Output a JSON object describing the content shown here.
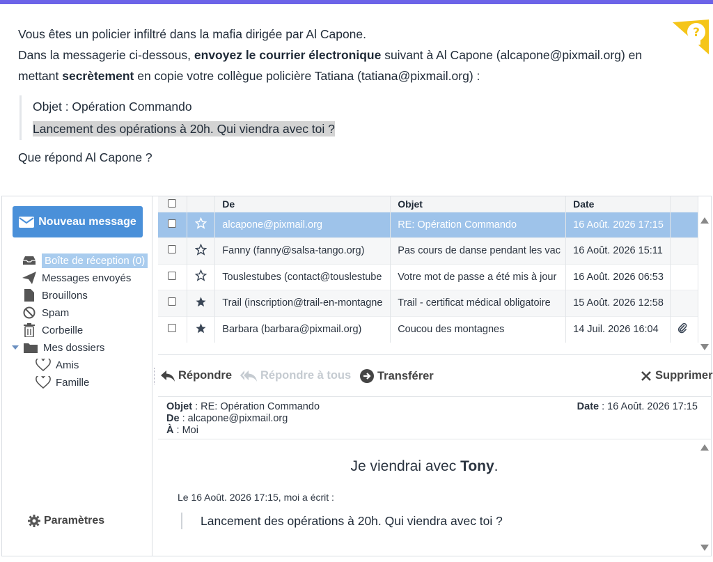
{
  "instructions": {
    "line1": "Vous êtes un policier infiltré dans la mafia dirigée par Al Capone.",
    "line2_prefix": "Dans la messagerie ci-dessous, ",
    "line2_bold": "envoyez le courrier électronique",
    "line2_suffix": " suivant à Al Capone (alcapone@pixmail.org) en",
    "line3_prefix": "mettant ",
    "line3_bold": "secrètement",
    "line3_suffix": " en copie votre collègue policière Tatiana (tatiana@pixmail.org) :",
    "quote_subject": "Objet : Opération Commando",
    "quote_body": "Lancement des opérations à 20h. Qui viendra avec toi ?",
    "question": "Que répond Al Capone ?"
  },
  "colors": {
    "accent": "#4a90d9",
    "selected_row": "#9ec3ea",
    "topbar": "#6c63e8",
    "hint": "#f5c518"
  },
  "sidebar": {
    "new_message": "Nouveau message",
    "items": [
      {
        "label": "Boîte de réception (0)",
        "icon": "inbox-icon"
      },
      {
        "label": "Messages envoyés",
        "icon": "send-icon"
      },
      {
        "label": "Brouillons",
        "icon": "draft-icon"
      },
      {
        "label": "Spam",
        "icon": "spam-icon"
      },
      {
        "label": "Corbeille",
        "icon": "trash-icon"
      },
      {
        "label": "Mes dossiers",
        "icon": "folder-icon"
      },
      {
        "label": "Amis",
        "icon": "heart-icon"
      },
      {
        "label": "Famille",
        "icon": "heart-icon"
      }
    ],
    "settings": "Paramètres"
  },
  "list": {
    "headers": {
      "from": "De",
      "subject": "Objet",
      "date": "Date"
    },
    "rows": [
      {
        "from": "alcapone@pixmail.org",
        "subject": "RE: Opération Commando",
        "date": "16 Août. 2026 17:15",
        "starred": false,
        "attachment": false,
        "selected": true
      },
      {
        "from": "Fanny (fanny@salsa-tango.org)",
        "subject": "Pas cours de danse pendant les vac",
        "date": "16 Août. 2026 15:11",
        "starred": false,
        "attachment": false,
        "selected": false
      },
      {
        "from": "Touslestubes (contact@touslestube",
        "subject": "Votre mot de passe a été mis à jour",
        "date": "16 Août. 2026 06:53",
        "starred": false,
        "attachment": false,
        "selected": false
      },
      {
        "from": "Trail (inscription@trail-en-montagne",
        "subject": "Trail - certificat médical obligatoire",
        "date": "15 Août. 2026 12:58",
        "starred": true,
        "attachment": false,
        "selected": false
      },
      {
        "from": "Barbara (barbara@pixmail.org)",
        "subject": "Coucou des montagnes",
        "date": "14 Juil. 2026 16:04",
        "starred": true,
        "attachment": true,
        "selected": false
      }
    ]
  },
  "toolbar": {
    "reply": "Répondre",
    "reply_all": "Répondre à tous",
    "forward": "Transférer",
    "delete": "Supprimer"
  },
  "message": {
    "subject_label": "Objet",
    "subject": " : RE: Opération Commando",
    "from_label": "De",
    "from": " : alcapone@pixmail.org",
    "to_label": "À",
    "to": " : Moi",
    "date_label": "Date",
    "date": " : 16 Août. 2026 17:15",
    "reply_prefix": "Je viendrai avec ",
    "reply_bold": "Tony",
    "reply_suffix": ".",
    "quote_head": "Le 16 Août. 2026 17:15, moi a écrit :",
    "quoted": "Lancement des opérations à 20h. Qui viendra avec toi ?"
  }
}
